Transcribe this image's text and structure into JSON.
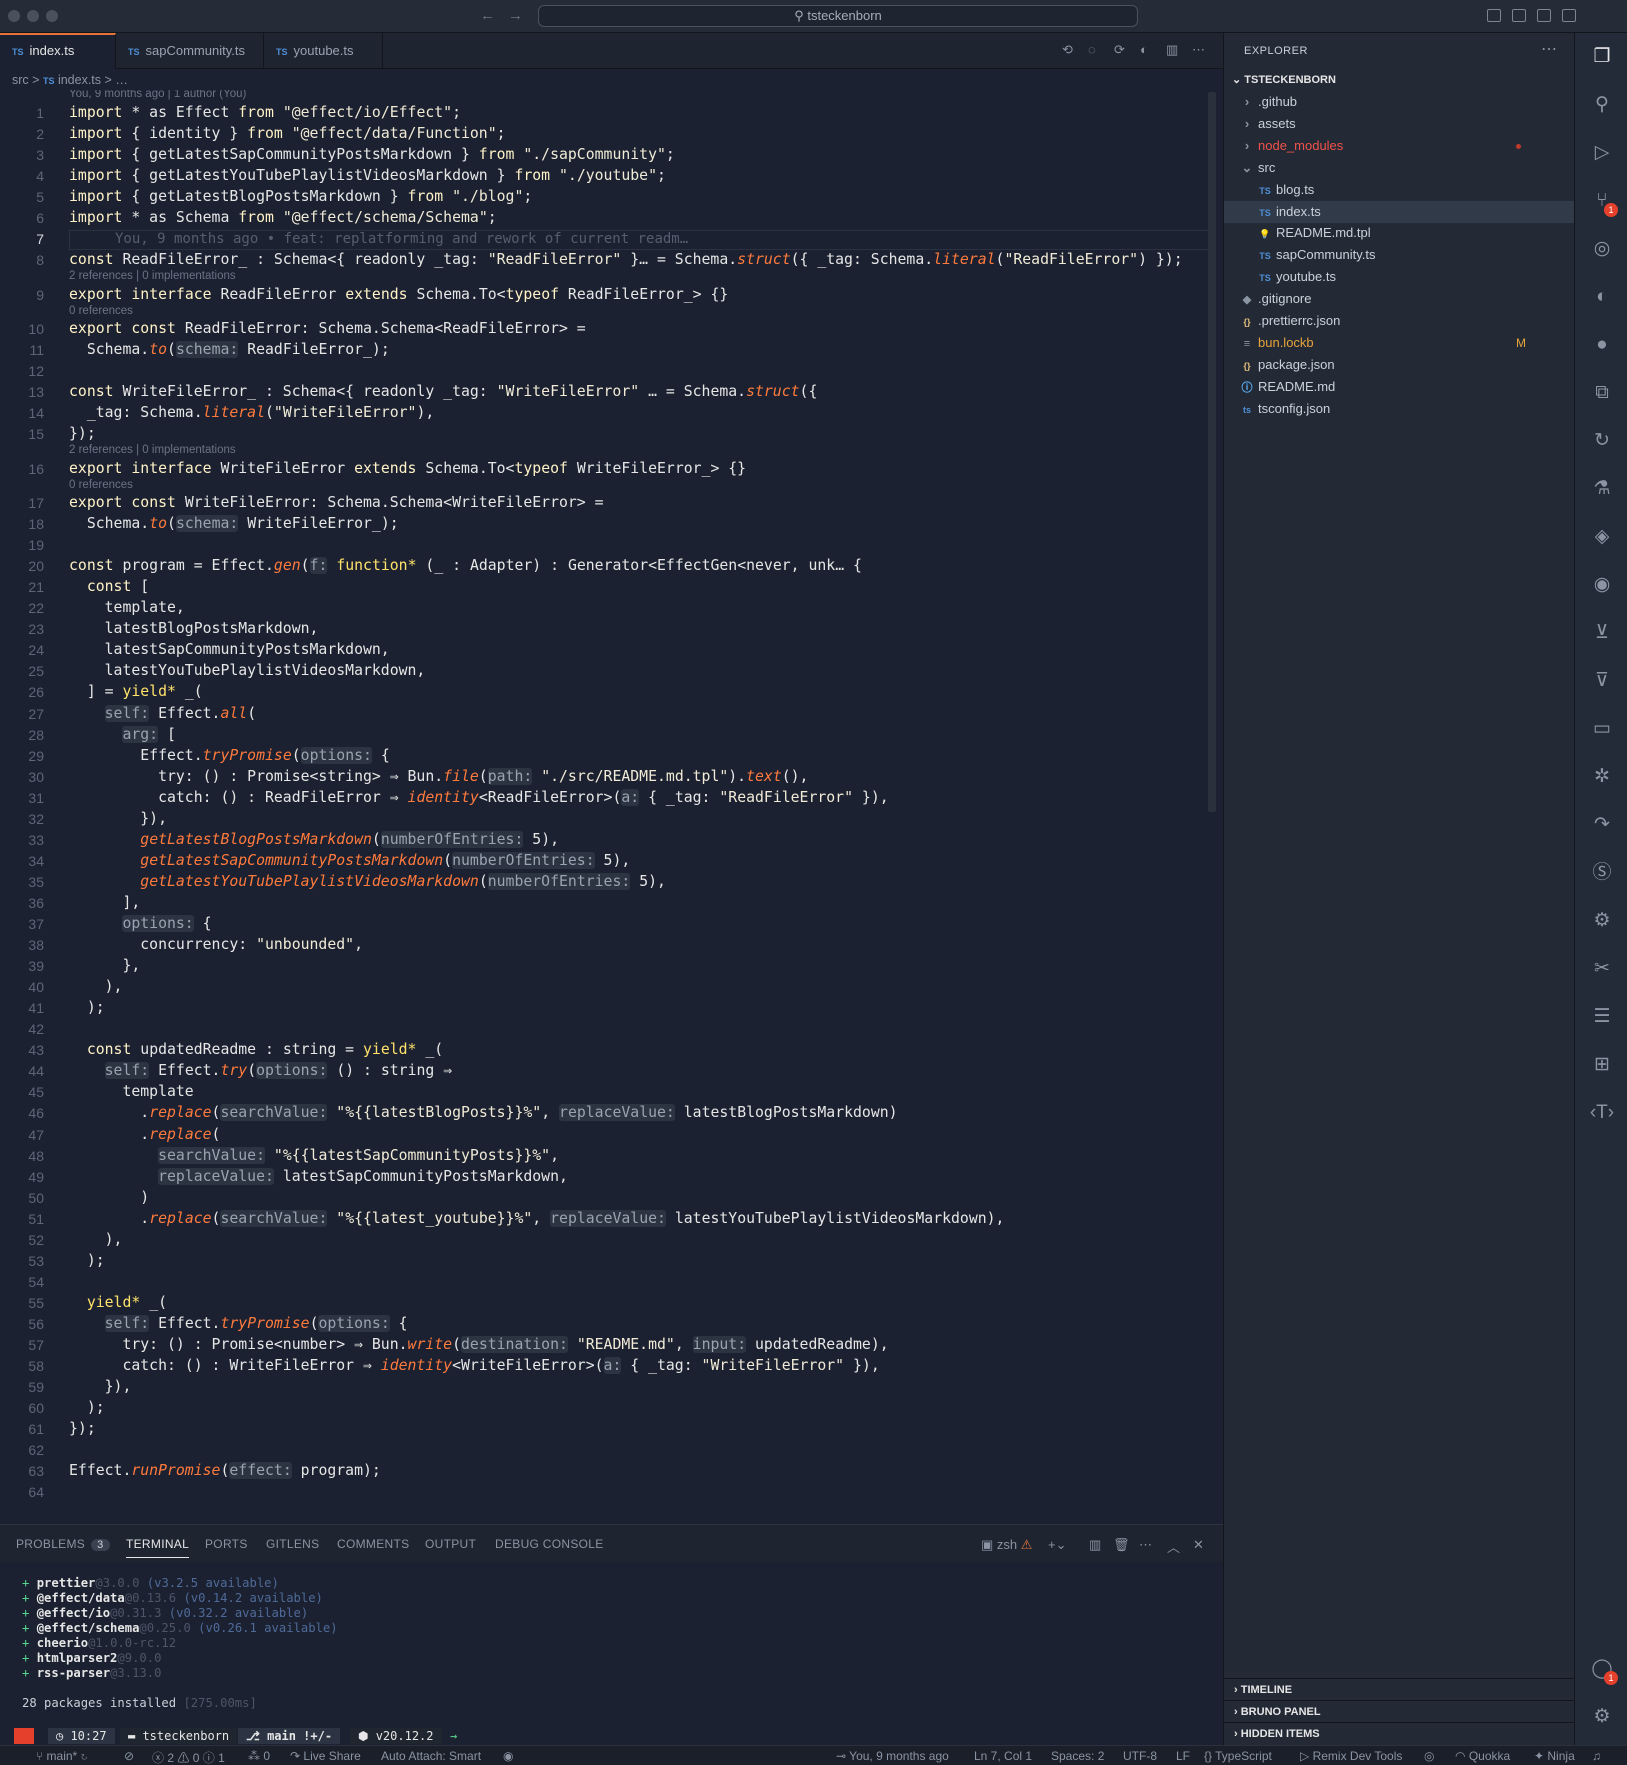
{
  "window": {
    "search_text": "tsteckenborn"
  },
  "tabs": [
    {
      "label": "index.ts",
      "icon": "TS"
    },
    {
      "label": "sapCommunity.ts",
      "icon": "TS"
    },
    {
      "label": "youtube.ts",
      "icon": "TS"
    }
  ],
  "breadcrumb": {
    "folder": "src",
    "file": "index.ts",
    "rest": "…",
    "sep": ">"
  },
  "blame_header": "You, 9 months ago | 1 author (You)",
  "blame_line7": "You, 9 months ago • feat: replatforming and rework of current readm…",
  "lens": {
    "l9": "2 references | 0 implementations",
    "l10": "0 references",
    "l16": "2 references | 0 implementations",
    "l17": "0 references"
  },
  "code_lines": [
    "import * as Effect from \"@effect/io/Effect\";",
    "import { identity } from \"@effect/data/Function\";",
    "import { getLatestSapCommunityPostsMarkdown } from \"./sapCommunity\";",
    "import { getLatestYouTubePlaylistVideosMarkdown } from \"./youtube\";",
    "import { getLatestBlogPostsMarkdown } from \"./blog\";",
    "import * as Schema from \"@effect/schema/Schema\";",
    "",
    "const ReadFileError_ : Schema<{ readonly _tag: \"ReadFileError\" }… = Schema.struct({ _tag: Schema.literal(\"ReadFileError\") });",
    "export interface ReadFileError extends Schema.To<typeof ReadFileError_> {}",
    "export const ReadFileError: Schema.Schema<ReadFileError> =",
    "  Schema.to(schema: ReadFileError_);",
    "",
    "const WriteFileError_ : Schema<{ readonly _tag: \"WriteFileError\" … = Schema.struct({",
    "  _tag: Schema.literal(\"WriteFileError\"),",
    "});",
    "export interface WriteFileError extends Schema.To<typeof WriteFileError_> {}",
    "export const WriteFileError: Schema.Schema<WriteFileError> =",
    "  Schema.to(schema: WriteFileError_);",
    "",
    "const program = Effect.gen(f: function* (_ : Adapter) : Generator<EffectGen<never, unk… {",
    "  const [",
    "    template,",
    "    latestBlogPostsMarkdown,",
    "    latestSapCommunityPostsMarkdown,",
    "    latestYouTubePlaylistVideosMarkdown,",
    "  ] = yield* _(",
    "    self: Effect.all(",
    "      arg: [",
    "        Effect.tryPromise(options: {",
    "          try: () : Promise<string> ⇒ Bun.file(path: \"./src/README.md.tpl\").text(),",
    "          catch: () : ReadFileError ⇒ identity<ReadFileError>(a: { _tag: \"ReadFileError\" }),",
    "        }),",
    "        getLatestBlogPostsMarkdown(numberOfEntries: 5),",
    "        getLatestSapCommunityPostsMarkdown(numberOfEntries: 5),",
    "        getLatestYouTubePlaylistVideosMarkdown(numberOfEntries: 5),",
    "      ],",
    "      options: {",
    "        concurrency: \"unbounded\",",
    "      },",
    "    ),",
    "  );",
    "",
    "  const updatedReadme : string = yield* _(",
    "    self: Effect.try(options: () : string ⇒",
    "      template",
    "        .replace(searchValue: \"%{{latestBlogPosts}}%\", replaceValue: latestBlogPostsMarkdown)",
    "        .replace(",
    "          searchValue: \"%{{latestSapCommunityPosts}}%\",",
    "          replaceValue: latestSapCommunityPostsMarkdown,",
    "        )",
    "        .replace(searchValue: \"%{{latest_youtube}}%\", replaceValue: latestYouTubePlaylistVideosMarkdown),",
    "    ),",
    "  );",
    "",
    "  yield* _(",
    "    self: Effect.tryPromise(options: {",
    "      try: () : Promise<number> ⇒ Bun.write(destination: \"README.md\", input: updatedReadme),",
    "      catch: () : WriteFileError ⇒ identity<WriteFileError>(a: { _tag: \"WriteFileError\" }),",
    "    }),",
    "  );",
    "});",
    "",
    "Effect.runPromise(effect: program);",
    ""
  ],
  "line_numbers": [
    "1",
    "2",
    "3",
    "4",
    "5",
    "6",
    "7",
    "8",
    "9",
    "10",
    "11",
    "12",
    "13",
    "14",
    "15",
    "16",
    "17",
    "18",
    "19",
    "20",
    "21",
    "22",
    "23",
    "24",
    "25",
    "26",
    "27",
    "28",
    "29",
    "30",
    "31",
    "32",
    "33",
    "34",
    "35",
    "36",
    "37",
    "38",
    "39",
    "40",
    "41",
    "42",
    "43",
    "44",
    "45",
    "46",
    "47",
    "48",
    "49",
    "50",
    "51",
    "52",
    "53",
    "54",
    "55",
    "56",
    "57",
    "58",
    "59",
    "60",
    "61",
    "62",
    "63",
    "64"
  ],
  "panel": {
    "tabs": [
      "PROBLEMS",
      "TERMINAL",
      "PORTS",
      "GITLENS",
      "COMMENTS",
      "OUTPUT",
      "DEBUG CONSOLE"
    ],
    "problems_count": "3",
    "shell": "zsh"
  },
  "terminal": {
    "packages": [
      {
        "name": "prettier",
        "version": "@3.0.0",
        "note": "(v3.2.5 available)"
      },
      {
        "name": "@effect/data",
        "version": "@0.13.6",
        "note": "(v0.14.2 available)"
      },
      {
        "name": "@effect/io",
        "version": "@0.31.3",
        "note": "(v0.32.2 available)"
      },
      {
        "name": "@effect/schema",
        "version": "@0.25.0",
        "note": "(v0.26.1 available)"
      },
      {
        "name": "cheerio",
        "version": "@1.0.0-rc.12",
        "note": ""
      },
      {
        "name": "htmlparser2",
        "version": "@9.0.0",
        "note": ""
      },
      {
        "name": "rss-parser",
        "version": "@3.13.0",
        "note": ""
      }
    ],
    "summary": "28 packages installed",
    "timing": "[275.00ms]",
    "prompt_time": "10:27",
    "prompt_dir": "tsteckenborn",
    "prompt_branch": "main !+/-",
    "prompt_node": "v20.12.2"
  },
  "explorer": {
    "title": "EXPLORER",
    "root": "TSTECKENBORN",
    "items": [
      {
        "label": ".github",
        "kind": "folder"
      },
      {
        "label": "assets",
        "kind": "folder"
      },
      {
        "label": "node_modules",
        "kind": "folder"
      },
      {
        "label": "src",
        "kind": "folder-open"
      },
      {
        "label": "blog.ts",
        "kind": "ts"
      },
      {
        "label": "index.ts",
        "kind": "ts"
      },
      {
        "label": "README.md.tpl",
        "kind": "tpl"
      },
      {
        "label": "sapCommunity.ts",
        "kind": "ts"
      },
      {
        "label": "youtube.ts",
        "kind": "ts"
      },
      {
        "label": ".gitignore",
        "kind": "git"
      },
      {
        "label": ".prettierrc.json",
        "kind": "json"
      },
      {
        "label": "bun.lockb",
        "kind": "bun"
      },
      {
        "label": "package.json",
        "kind": "json"
      },
      {
        "label": "README.md",
        "kind": "info"
      },
      {
        "label": "tsconfig.json",
        "kind": "tsconfig"
      }
    ],
    "modified_marker": "M",
    "sections": [
      "TIMELINE",
      "BRUNO PANEL",
      "HIDDEN ITEMS"
    ]
  },
  "status": {
    "branch": "main*",
    "errors": "2",
    "warnings": "0",
    "info": "1",
    "ports": "0",
    "live_share": "Live Share",
    "auto_attach": "Auto Attach: Smart",
    "blame": "You, 9 months ago",
    "position": "Ln 7, Col 1",
    "spaces": "Spaces: 2",
    "encoding": "UTF-8",
    "eol": "LF",
    "language": "TypeScript",
    "remix": "Remix Dev Tools",
    "quokka": "Quokka",
    "ninja": "Ninja"
  },
  "activity_badges": {
    "scm": "1",
    "account": "1"
  },
  "colors": {
    "accent": "#e8733a",
    "keyword": "#fff2c7",
    "function": "#ff7a3d",
    "type": "#f3cf7a",
    "identifier": "#5db7ff",
    "badge": "#e5402c"
  }
}
